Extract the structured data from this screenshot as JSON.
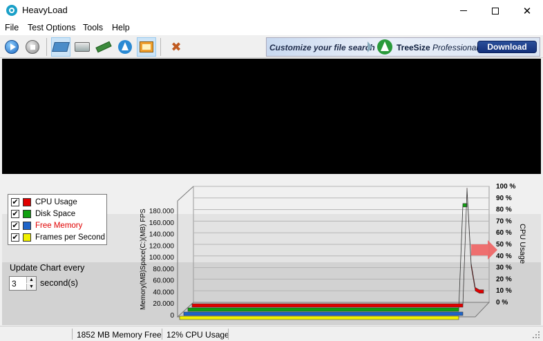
{
  "window": {
    "title": "HeavyLoad"
  },
  "menu": [
    "File",
    "Test Options",
    "Tools",
    "Help"
  ],
  "toolbar": {
    "buttons": [
      "play-icon",
      "stop-icon",
      "cpu-icon",
      "disk-icon",
      "memory-icon",
      "treesize-icon",
      "gpu-icon",
      "tools-icon"
    ]
  },
  "ad": {
    "tagline": "Customize your file search",
    "brand_bold": "TreeSize",
    "brand_italic": "Professional",
    "download": "Download"
  },
  "legend": [
    {
      "label": "CPU Usage",
      "color": "#e00000",
      "checked": "✔"
    },
    {
      "label": "Disk Space",
      "color": "#10a010",
      "checked": "✔"
    },
    {
      "label": "Free Memory",
      "color": "#1e64c8",
      "checked": "✔",
      "label_color": "#e00000"
    },
    {
      "label": "Frames per Second",
      "color": "#f0f000",
      "checked": "✔"
    }
  ],
  "update": {
    "label": "Update Chart every",
    "value": "3",
    "unit": "second(s)"
  },
  "chart_data": {
    "type": "line",
    "left_axis_label": "Memory(MB)Space(C:)(MB) FPS",
    "left_ticks": [
      "0",
      "20.000",
      "40.000",
      "60.000",
      "80.000",
      "100.000",
      "120.000",
      "140.000",
      "160.000",
      "180.000"
    ],
    "right_axis_label": "CPU Usage",
    "right_ticks": [
      "0 %",
      "10 %",
      "20 %",
      "30 %",
      "40 %",
      "50 %",
      "60 %",
      "70 %",
      "80 %",
      "90 %",
      "100 %"
    ],
    "current_cpu_percent": 12,
    "series": [
      {
        "name": "CPU Usage",
        "color": "#e00000",
        "end_values_percent": [
          0,
          100,
          35,
          14,
          12,
          12
        ]
      },
      {
        "name": "Disk Space",
        "color": "#10a010",
        "end_values_percent": [
          0,
          90,
          90
        ]
      },
      {
        "name": "Free Memory",
        "color": "#1e64c8",
        "end_values_percent": [
          0,
          0,
          0
        ]
      },
      {
        "name": "Frames per Second",
        "color": "#f0f000",
        "end_values_percent": [
          0,
          0,
          0
        ]
      }
    ]
  },
  "status": {
    "memory": "1852 MB Memory Free",
    "cpu": "12% CPU Usage"
  }
}
